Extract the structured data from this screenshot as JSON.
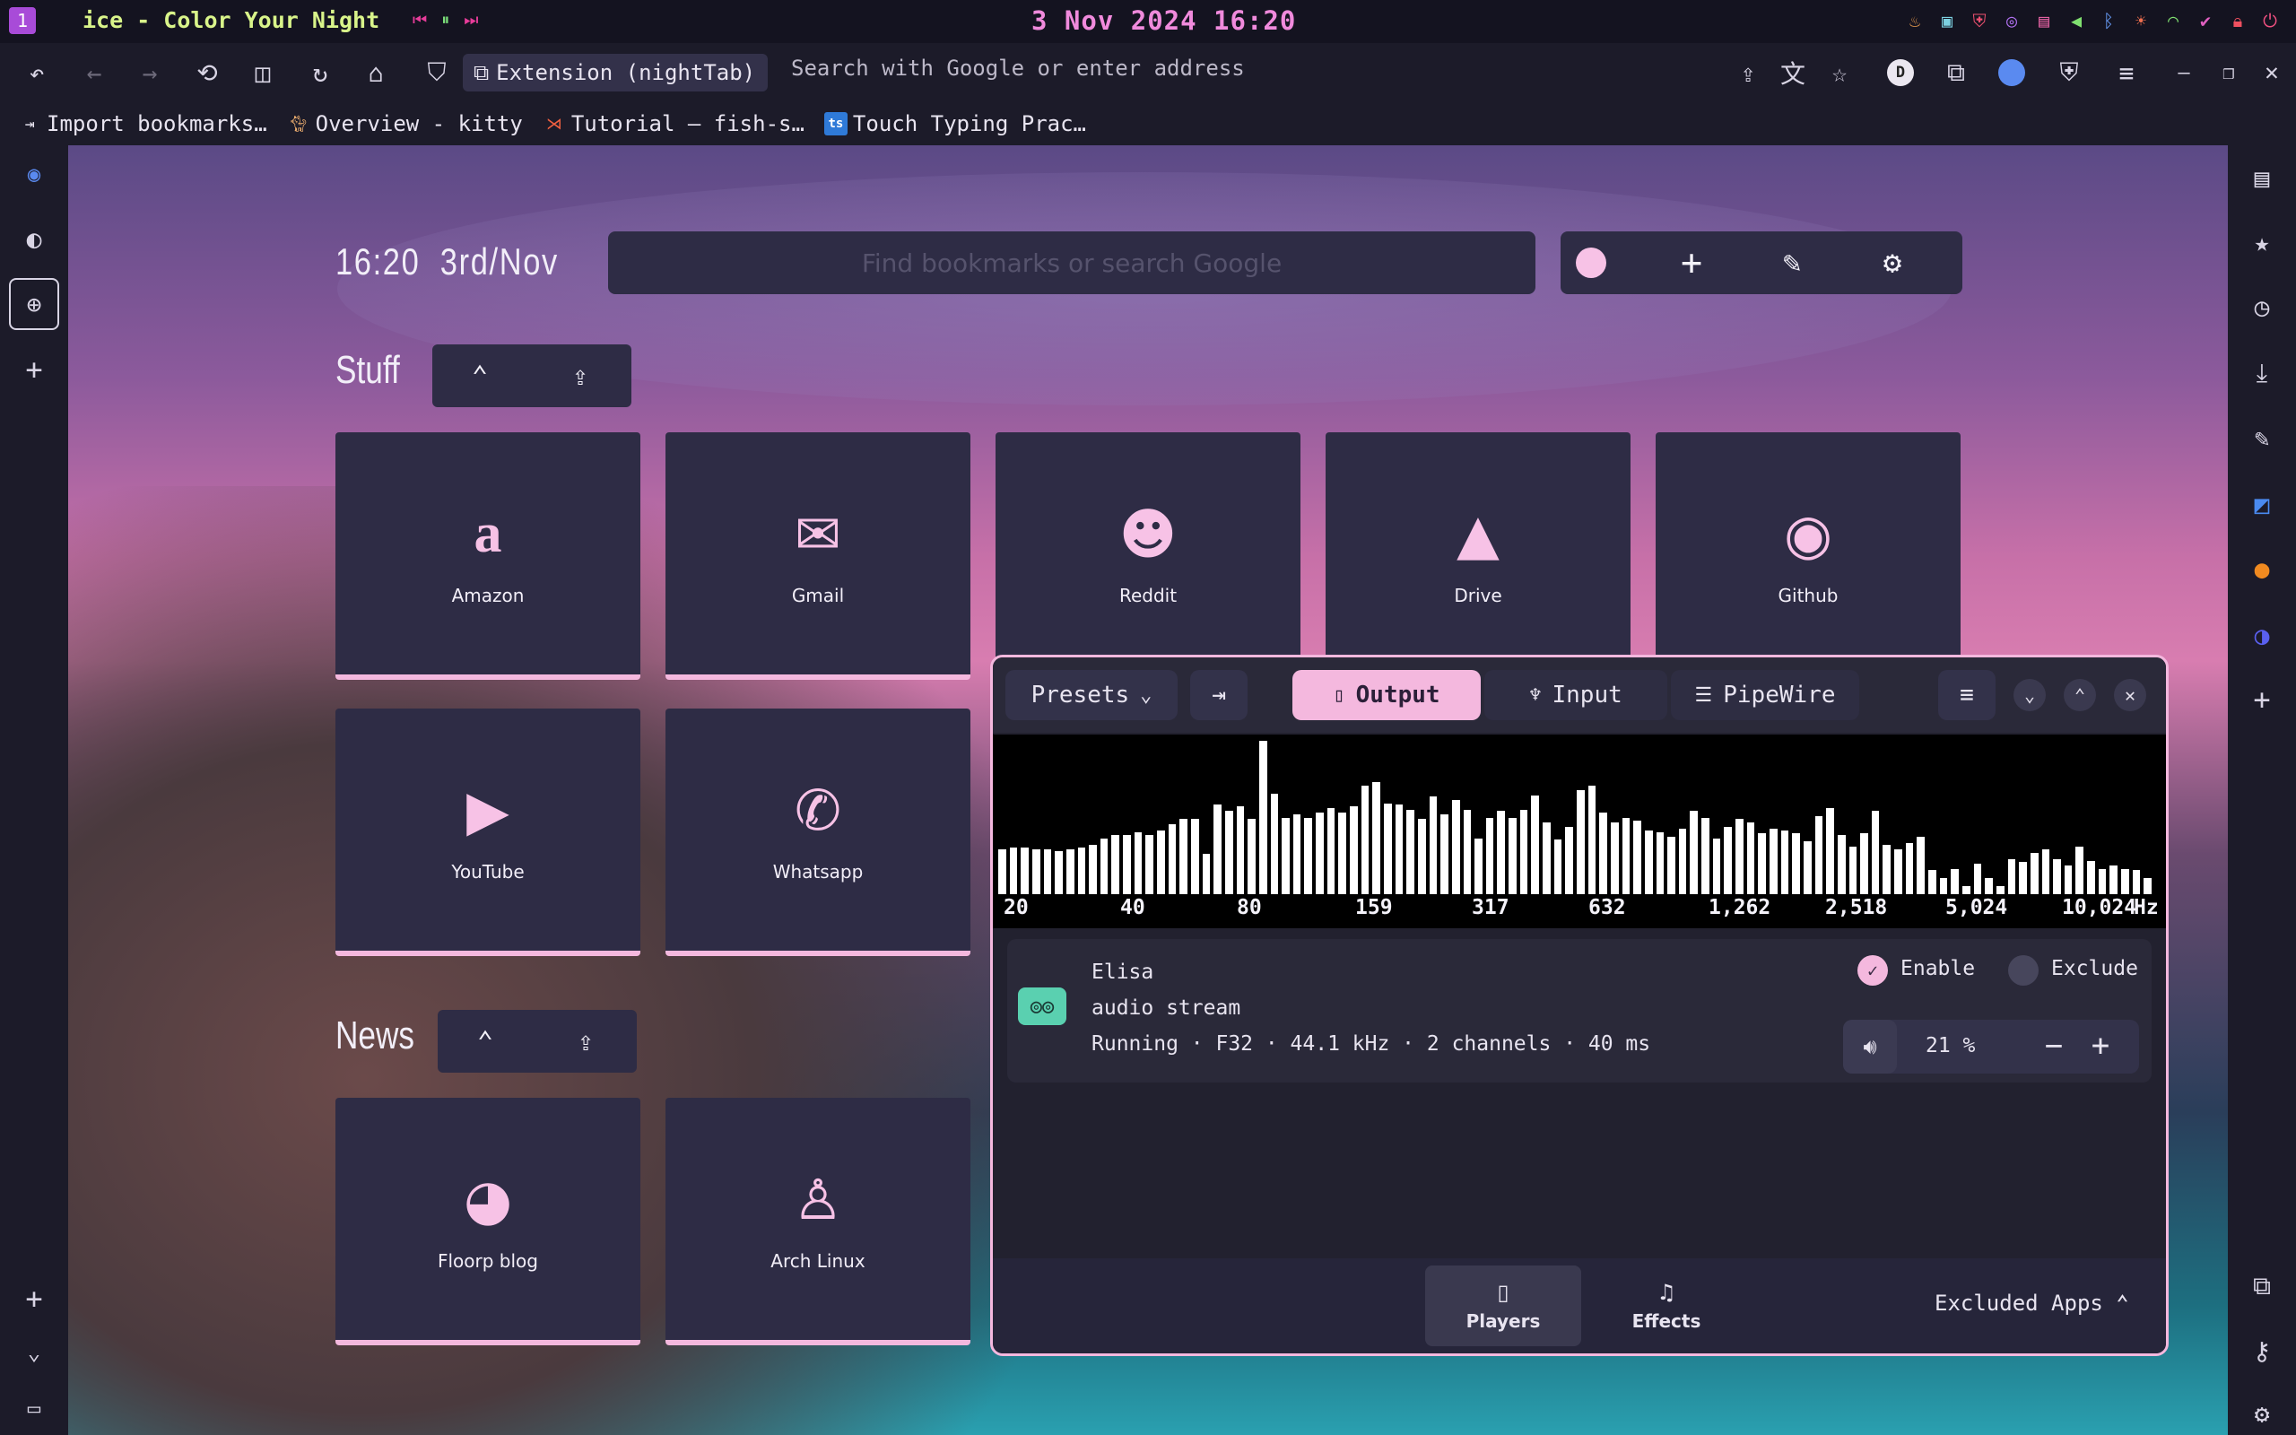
{
  "system_bar": {
    "workspace": "1",
    "window_title": "ice - Color Your Night",
    "media_controls": [
      "⏮",
      "⏸",
      "⏭"
    ],
    "clock": "3 Nov 2024 16:20",
    "tray_icons": [
      "network-icon",
      "display-icon",
      "shield-icon",
      "sync-icon",
      "battery-icon",
      "speaker-icon",
      "bluetooth-icon",
      "brightness-icon",
      "wifi-icon",
      "check-icon",
      "lock-icon",
      "power-icon"
    ]
  },
  "browser": {
    "extension_label": "Extension (nightTab)",
    "address_placeholder": "Search with Google or enter address",
    "profile_letter": "D",
    "bookmarks": [
      {
        "label": "Import bookmarks…",
        "icon": "import-icon"
      },
      {
        "label": "Overview - kitty",
        "icon": "kitty-icon"
      },
      {
        "label": "Tutorial — fish-s…",
        "icon": "fish-icon"
      },
      {
        "label": "Touch Typing Prac…",
        "icon": "ts-icon"
      }
    ]
  },
  "nighttab": {
    "time": "16:20",
    "date": "3rd/Nov",
    "search_placeholder": "Find bookmarks or search Google",
    "groups": [
      {
        "title": "Stuff",
        "tiles": [
          {
            "label": "Amazon",
            "icon": "amazon-icon"
          },
          {
            "label": "Gmail",
            "icon": "mail-icon"
          },
          {
            "label": "Reddit",
            "icon": "reddit-icon"
          },
          {
            "label": "Drive",
            "icon": "drive-icon"
          },
          {
            "label": "Github",
            "icon": "github-icon"
          },
          {
            "label": "YouTube",
            "icon": "youtube-icon"
          },
          {
            "label": "Whatsapp",
            "icon": "whatsapp-icon"
          }
        ]
      },
      {
        "title": "News",
        "tiles": [
          {
            "label": "Floorp blog",
            "icon": "floorp-icon"
          },
          {
            "label": "Arch Linux",
            "icon": "tux-icon"
          }
        ]
      }
    ]
  },
  "easyeffects": {
    "presets_label": "Presets",
    "tabs": [
      "Output",
      "Input",
      "PipeWire"
    ],
    "active_tab": "Output",
    "spectrum_ticks": [
      "20",
      "40",
      "80",
      "159",
      "317",
      "632",
      "1,262",
      "2,518",
      "5,024",
      "10,024"
    ],
    "spectrum_unit": "Hz",
    "spectrum_levels": [
      0.28,
      0.29,
      0.29,
      0.28,
      0.28,
      0.27,
      0.28,
      0.29,
      0.31,
      0.35,
      0.37,
      0.37,
      0.39,
      0.37,
      0.4,
      0.44,
      0.47,
      0.47,
      0.25,
      0.56,
      0.52,
      0.55,
      0.47,
      0.96,
      0.63,
      0.48,
      0.5,
      0.48,
      0.51,
      0.54,
      0.51,
      0.55,
      0.68,
      0.7,
      0.57,
      0.56,
      0.53,
      0.47,
      0.61,
      0.5,
      0.59,
      0.53,
      0.35,
      0.48,
      0.52,
      0.48,
      0.53,
      0.62,
      0.45,
      0.34,
      0.42,
      0.65,
      0.68,
      0.51,
      0.45,
      0.48,
      0.46,
      0.4,
      0.39,
      0.36,
      0.41,
      0.52,
      0.48,
      0.35,
      0.42,
      0.47,
      0.45,
      0.38,
      0.41,
      0.4,
      0.38,
      0.33,
      0.49,
      0.54,
      0.37,
      0.3,
      0.38,
      0.52,
      0.31,
      0.28,
      0.32,
      0.36,
      0.15,
      0.1,
      0.16,
      0.05,
      0.19,
      0.1,
      0.05,
      0.22,
      0.2,
      0.26,
      0.28,
      0.22,
      0.18,
      0.3,
      0.21,
      0.16,
      0.18,
      0.16,
      0.15,
      0.1
    ],
    "player": {
      "name": "Elisa",
      "type": "audio stream",
      "details": "Running · F32 · 44.1 kHz · 2 channels · 40 ms",
      "enable_label": "Enable",
      "exclude_label": "Exclude",
      "volume": "21 %"
    },
    "footer_tabs": [
      "Players",
      "Effects"
    ],
    "excluded_apps_label": "Excluded Apps"
  }
}
